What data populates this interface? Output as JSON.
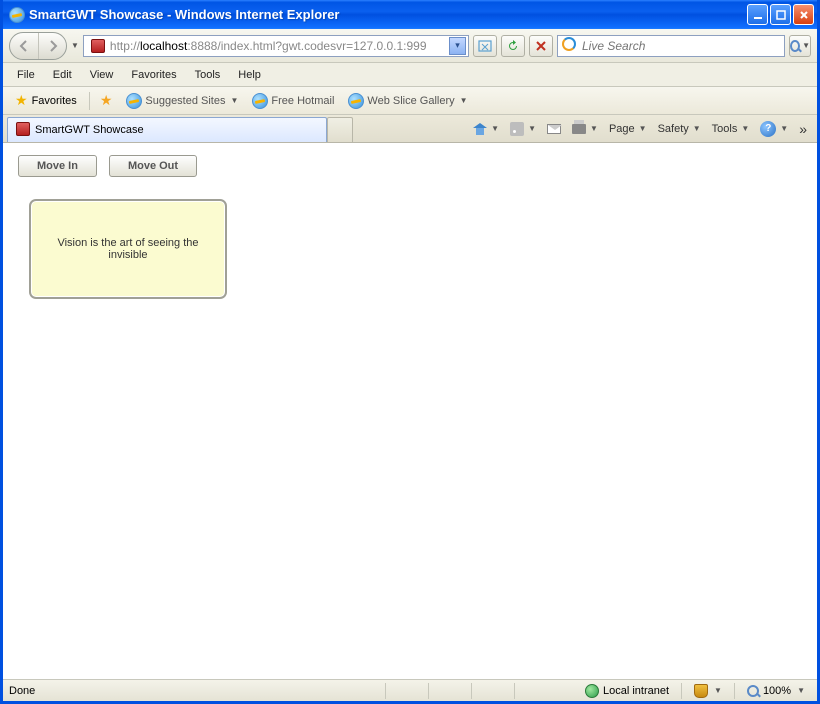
{
  "titlebar": {
    "title": "SmartGWT Showcase - Windows Internet Explorer"
  },
  "addressbar": {
    "prefix": "http://",
    "host": "localhost",
    "rest": ":8888/index.html?gwt.codesvr=127.0.0.1:999"
  },
  "search": {
    "placeholder": "Live Search"
  },
  "menu": {
    "file": "File",
    "edit": "Edit",
    "view": "View",
    "favorites": "Favorites",
    "tools": "Tools",
    "help": "Help"
  },
  "favbar": {
    "favorites": "Favorites",
    "suggested": "Suggested Sites",
    "hotmail": "Free Hotmail",
    "webslice": "Web Slice Gallery"
  },
  "tab": {
    "label": "SmartGWT Showcase"
  },
  "cmdbar": {
    "page": "Page",
    "safety": "Safety",
    "tools": "Tools"
  },
  "content": {
    "movein": "Move In",
    "moveout": "Move Out",
    "note": "Vision is the art of seeing the invisible"
  },
  "status": {
    "done": "Done",
    "zone": "Local intranet",
    "zoom": "100%"
  }
}
